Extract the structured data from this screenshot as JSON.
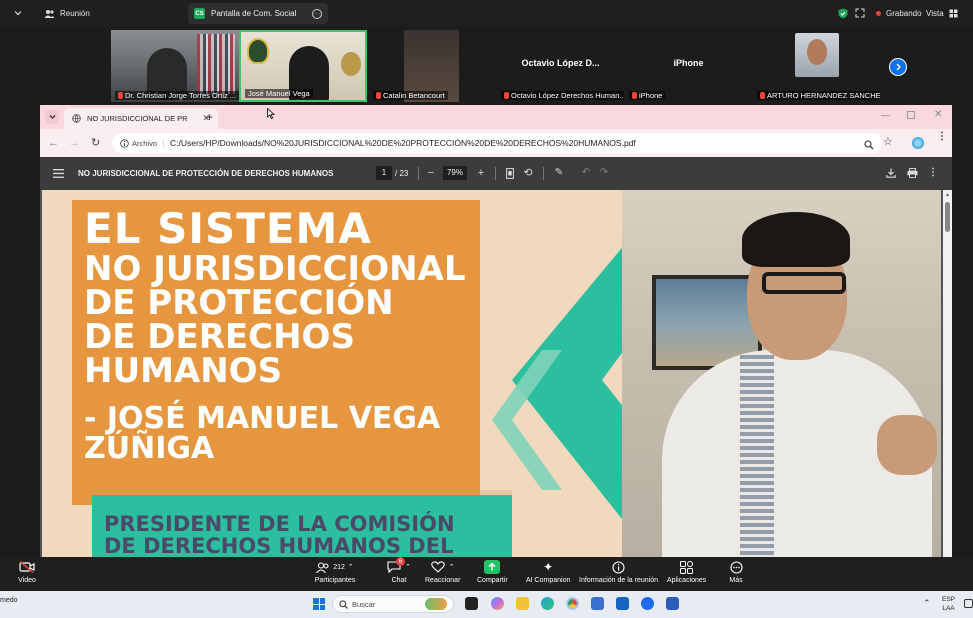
{
  "zoom_top": {
    "meeting_label": "Reunión",
    "share_tab_badge": "CS",
    "share_tab_label": "Pantalla de Com. Social",
    "recording_label": "Grabando",
    "view_label": "Vista"
  },
  "participants_strip": [
    {
      "name": "Dr. Christian Jorge Torres Ortiz ...",
      "muted": true
    },
    {
      "name": "José Manuel Vega",
      "muted": false
    },
    {
      "name": "Catalin Betancourt",
      "muted": true
    },
    {
      "name": "Octavio López Derechos Human...",
      "muted": true,
      "tile_text": "Octavio  López  D..."
    },
    {
      "name": "iPhone",
      "muted": true,
      "tile_text": "iPhone"
    },
    {
      "name": "ARTURO HERNANDEZ SANCHEZ",
      "muted": true
    }
  ],
  "browser": {
    "tab_title": "NO JURISDICCIONAL DE PROTE",
    "new_tab": "+",
    "site_chip": "Archivo",
    "url": "C:/Users/HP/Downloads/NO%20JURISDICCIONAL%20DE%20PROTECCIÓN%20DE%20DERECHOS%20HUMANOS.pdf"
  },
  "pdf": {
    "doc_title": "NO JURISDICCIONAL DE PROTECCIÓN DE DERECHOS HUMANOS",
    "page_current": "1",
    "page_total": "/ 23",
    "zoom": "79%",
    "slide_line1": "EL SISTEMA",
    "slide_line2": "NO JURISDICCIONAL",
    "slide_line3": "DE PROTECCIÓN",
    "slide_line4": "DE DERECHOS",
    "slide_line5": "HUMANOS",
    "slide_author1": "- JOSÉ MANUEL VEGA",
    "slide_author2": "ZÚÑIGA",
    "slide_sub1": "PRESIDENTE DE LA COMISIÓN",
    "slide_sub2": "DE DERECHOS HUMANOS DEL"
  },
  "zoom_bottom": {
    "video": "Video",
    "participants_count": "212",
    "participants": "Participantes",
    "chat_badge": "6",
    "chat": "Chat",
    "react": "Reaccionar",
    "share": "Compartir",
    "ai": "AI Companion",
    "info": "Información de la reunión",
    "apps": "Aplicaciones",
    "more": "Más"
  },
  "taskbar": {
    "left_text": "medo",
    "search_placeholder": "Buscar",
    "lang1": "ESP",
    "lang2": "LAA"
  },
  "colors": {
    "orange": "#e6963f",
    "teal": "#2bbf9f",
    "page_bg": "#f1d9bd",
    "chrome_pink": "#f9d9de"
  }
}
